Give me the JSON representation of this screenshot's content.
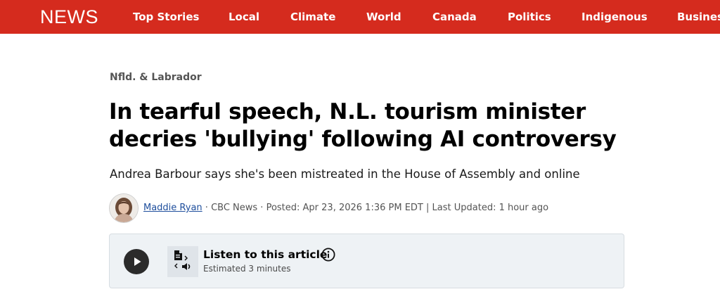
{
  "nav": {
    "logo": "NEWS",
    "items": [
      "Top Stories",
      "Local",
      "Climate",
      "World",
      "Canada",
      "Politics",
      "Indigenous",
      "Business"
    ],
    "background_color": "#d52b1e"
  },
  "article": {
    "section": "Nfld. & Labrador",
    "headline": "In tearful speech, N.L. tourism minister decries 'bullying' following AI controversy",
    "dek": "Andrea Barbour says she's been mistreated in the House of Assembly and online",
    "byline": {
      "author": "Maddie Ryan",
      "outlet": "CBC News",
      "posted": "Posted: Apr 23, 2026 1:36 PM EDT",
      "updated": "Last Updated: 1 hour ago",
      "separator": " · ",
      "pipe": " | ",
      "author_color": "#1e4e9c"
    }
  },
  "listen": {
    "title": "Listen to this article",
    "subtitle": "Estimated 3 minutes",
    "icons": [
      "play-icon",
      "text-to-speech-icon",
      "info-icon"
    ]
  }
}
